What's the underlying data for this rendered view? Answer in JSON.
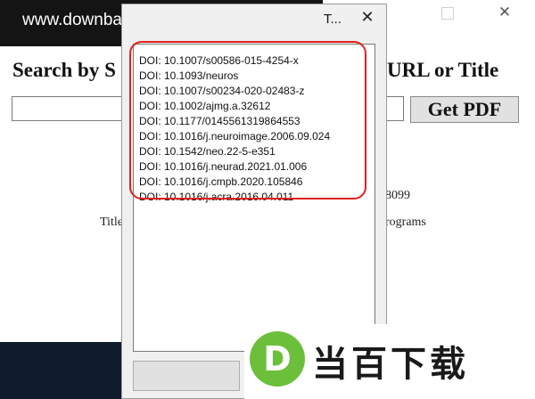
{
  "background_window": {
    "close_glyph": "✕",
    "heading_left": "Search by S",
    "heading_right": "URL or Title",
    "get_pdf_label": "Get PDF",
    "fragment_1": "8099",
    "fragment_2": "Title",
    "fragment_3": "rograms"
  },
  "watermark_top": {
    "text": "www.downbai.com"
  },
  "dialog": {
    "title_fragment": "T...",
    "close_glyph": "✕",
    "doi_items": [
      "DOI: 10.1007/s00586-015-4254-x",
      "DOI: 10.1093/neuros",
      "DOI: 10.1007/s00234-020-02483-z",
      "DOI: 10.1002/ajmg.a.32612",
      "DOI: 10.1177/0145561319864553",
      "DOI: 10.1016/j.neuroimage.2006.09.024",
      "DOI: 10.1542/neo.22-5-e351",
      "DOI: 10.1016/j.neurad.2021.01.006",
      "DOI: 10.1016/j.cmpb.2020.105846",
      "DOI: 10.1016/j.acra.2016.04.011"
    ]
  },
  "watermark_logo": {
    "letter": "D",
    "text": "当百下载"
  },
  "colors": {
    "highlight": "#e0211f",
    "logo_green": "#6cbf3b",
    "bottom_bar": "#0f1c2e"
  }
}
